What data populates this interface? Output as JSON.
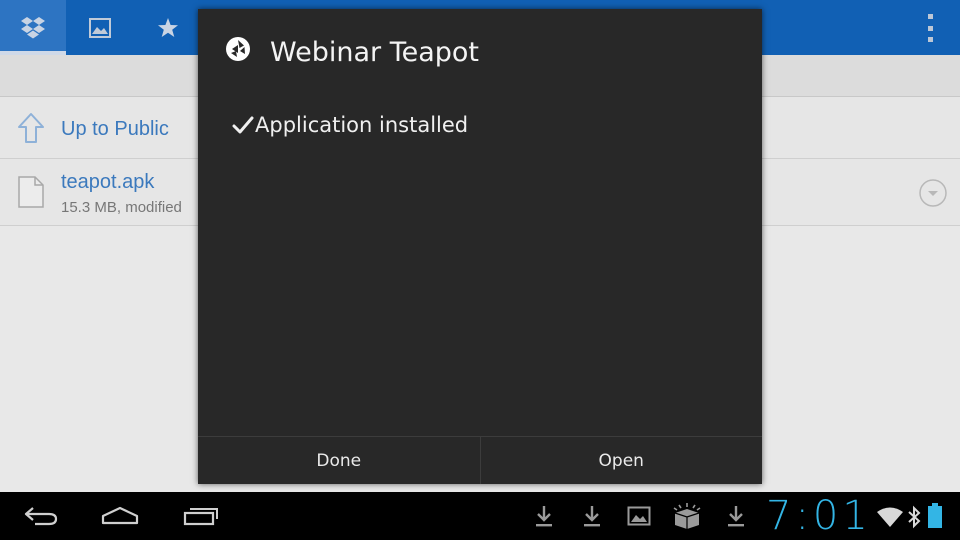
{
  "topbar": {
    "tabs": [
      {
        "icon": "dropbox-icon",
        "active": true
      },
      {
        "icon": "photos-icon",
        "active": false
      },
      {
        "icon": "star-icon",
        "active": false
      }
    ],
    "menu_icon": "overflow-menu-icon"
  },
  "browser": {
    "up_label": "Up to Public",
    "file": {
      "name": "teapot.apk",
      "meta": "15.3 MB, modified"
    }
  },
  "dialog": {
    "title": "Webinar Teapot",
    "message": "Application installed",
    "buttons": {
      "done": "Done",
      "open": "Open"
    }
  },
  "system_bar": {
    "nav": [
      "back-icon",
      "home-icon",
      "recent-apps-icon"
    ],
    "notifications": [
      "download-icon",
      "download-icon",
      "image-icon",
      "package-icon",
      "download-icon"
    ],
    "clock": "7:01",
    "colors": {
      "clock": "#33b5e5",
      "battery": "#33b5e5"
    }
  }
}
